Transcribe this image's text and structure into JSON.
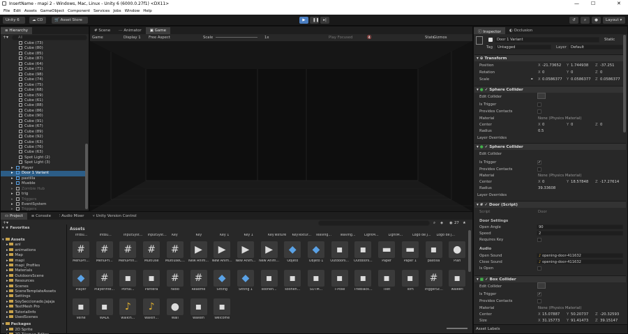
{
  "window": {
    "title": "InsertName - mapi 2 - Windows, Mac, Linux - Unity 6 (6000.0.27f1) <DX11>",
    "minimize": "—",
    "maximize": "☐",
    "close": "✕"
  },
  "menu": [
    "File",
    "Edit",
    "Assets",
    "GameObject",
    "Component",
    "Services",
    "Jobs",
    "Window",
    "Help"
  ],
  "toolbar": {
    "unity": "Unity 6",
    "cloud": "CD",
    "asset_store": "Asset Store",
    "layout": "Layout"
  },
  "hierarchy": {
    "tab": "Hierarchy",
    "search_placeholder": "All",
    "items": [
      "Cube (73)",
      "Cube (80)",
      "Cube (85)",
      "Cube (87)",
      "Cube (64)",
      "Cube (71)",
      "Cube (98)",
      "Cube (74)",
      "Cube (75)",
      "Cube (68)",
      "Cube (59)",
      "Cube (61)",
      "Cube (88)",
      "Cube (86)",
      "Cube (90)",
      "Cube (91)",
      "Cube (67)",
      "Cube (89)",
      "Cube (92)",
      "Cube (63)",
      "Cube (76)",
      "Cube (63)",
      "Spot Light (2)",
      "Spot Light (3)",
      "Player",
      "Door 1 Variant",
      "pastilla",
      "Mueble",
      "Zombie Hub",
      "trig",
      "Triggers",
      "EventSystem",
      "Triggers"
    ]
  },
  "scene": {
    "tabs": [
      "Scene",
      "Animator",
      "Game"
    ],
    "game_dropdown": "Game",
    "display": "Display 1",
    "aspect": "Free Aspect",
    "scale_label": "Scale",
    "scale_value": "1x",
    "play_focused": "Play Focused",
    "stats": "Stats",
    "gizmos": "Gizmos"
  },
  "inspector": {
    "tabs": [
      "Inspector",
      "Occlusion"
    ],
    "object_name": "Door 1 Variant",
    "static": "Static",
    "tag_label": "Tag",
    "tag_value": "Untagged",
    "layer_label": "Layer",
    "layer_value": "Default",
    "transform": {
      "title": "Transform",
      "position": [
        "Position",
        "-21.73652",
        "1.744938",
        "-37.251"
      ],
      "rotation": [
        "Rotation",
        "0",
        "0",
        "0"
      ],
      "scale": [
        "Scale",
        "0.0586377",
        "0.0586377",
        "0.0586377"
      ]
    },
    "sphere1": {
      "title": "Sphere Collider",
      "edit": "Edit Collider",
      "is_trigger": "Is Trigger",
      "provides": "Provides Contacts",
      "material_label": "Material",
      "material": "None (Physics Material)",
      "center_label": "Center",
      "center": [
        "0",
        "0",
        "0"
      ],
      "radius_label": "Radius",
      "radius": "0.5",
      "layer_overrides": "Layer Overrides"
    },
    "sphere2": {
      "title": "Sphere Collider",
      "edit": "Edit Collider",
      "is_trigger": "Is Trigger",
      "provides": "Provides Contacts",
      "material_label": "Material",
      "material": "None (Physics Material)",
      "center_label": "Center",
      "center": [
        "0",
        "18.57848",
        "-17.27614"
      ],
      "radius_label": "Radius",
      "radius": "39.33608",
      "layer_overrides": "Layer Overrides"
    },
    "door": {
      "title": "Door (Script)",
      "script_label": "Script",
      "script": "Door",
      "settings": "Door Settings",
      "open_angle_label": "Open Angle",
      "open_angle": "90",
      "speed_label": "Speed",
      "speed": "2",
      "requires_key": "Requires Key",
      "audio": "Audio",
      "open_sound_label": "Open Sound",
      "open_sound": "opening-door-411632",
      "close_sound_label": "Close Sound",
      "close_sound": "opening-door-411632",
      "is_open": "Is Open"
    },
    "box": {
      "title": "Box Collider",
      "edit": "Edit Collider",
      "is_trigger": "Is Trigger",
      "provides": "Provides Contacts",
      "material_label": "Material",
      "material": "None (Physics Material)",
      "center_label": "Center",
      "center": [
        "15.07887",
        "50.20737",
        "-20.32593"
      ],
      "size_label": "Size",
      "size": [
        "31.15773",
        "91.41473",
        "39.15147"
      ]
    },
    "asset_labels": "Asset Labels"
  },
  "project": {
    "tabs": [
      "Project",
      "Console",
      "Audio Mixer",
      "Unity Version Control"
    ],
    "count": "27",
    "favorites": "Favorites",
    "tree": [
      "Assets",
      "anl",
      "animations",
      "Map",
      "mapi",
      "mapi_Profiles",
      "Materials",
      "OutdoorsScene",
      "Resources",
      "Scenes",
      "SceneTemplateAssets",
      "Settings",
      "SoySeccionado.Jajaja",
      "TextMesh Pro",
      "TutorialInfo",
      "UsedScenes",
      "Packages",
      "2D Sprite",
      "2D Tilemap Editor"
    ],
    "breadcrumb": "Assets",
    "top_strip": [
      "IntBu...",
      "IntBu...",
      "InputSyst...",
      "InputSyst...",
      "Key",
      "Key",
      "Key 1",
      "Key 1",
      "KeyTexture",
      "KeyTextur...",
      "leaving...",
      "leaving...",
      "LightM...",
      "LightM...",
      "Logo de J...",
      "Logo de J..."
    ],
    "row1": [
      "MenuPri...",
      "MenuPri...",
      "MenuPrin...",
      "MultiUse",
      "MultiuseC...",
      "New Anim...",
      "New Anim...",
      "New Anim...",
      "New Anim...",
      "Objeto",
      "Objeto 1",
      "Outdoors...",
      "Outdoors...",
      "Paper",
      "Paper 1",
      "pastilla",
      "Plan"
    ],
    "row2": [
      "Player",
      "PlayerInte...",
      "Portal...",
      "Pantera",
      "radio",
      "Readme",
      "Sitting",
      "Sitting 1",
      "soonen...",
      "soonen...",
      "SOTM...",
      "T-Pose",
      "TheBlack...",
      "Tilet",
      "Torn",
      "TriggerSc...",
      "walkeri"
    ],
    "row3": [
      "Veine",
      "WALK",
      "walkin...",
      "walkin...",
      "Wall",
      "walken",
      "Welcome"
    ]
  },
  "colors": {
    "accent": "#3a79bb",
    "green": "#43b14b",
    "bg": "#282828"
  }
}
